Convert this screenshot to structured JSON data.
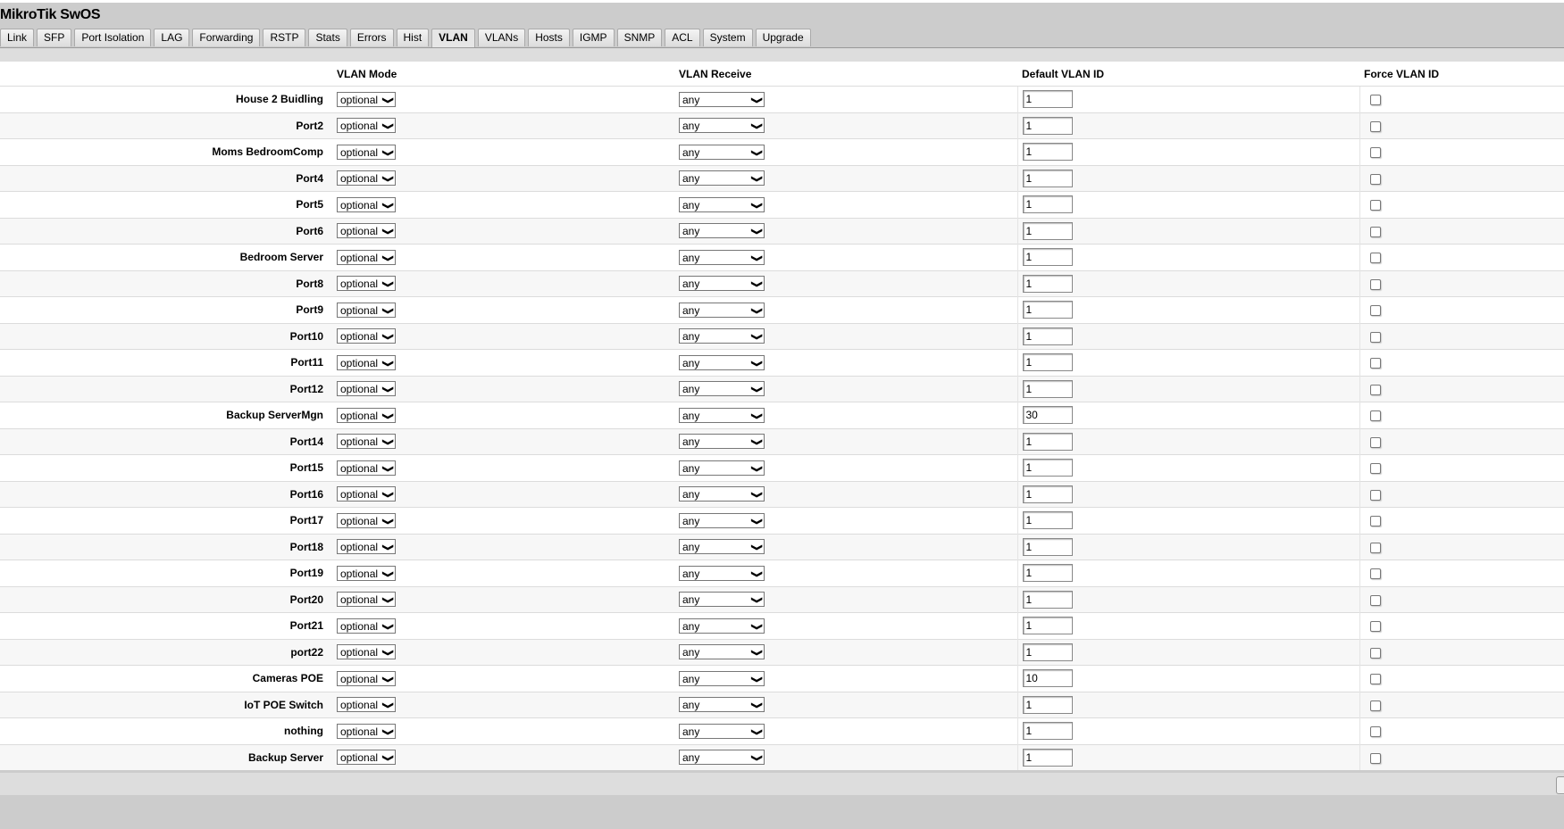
{
  "app": {
    "title": "MikroTik SwOS"
  },
  "tabs": [
    {
      "label": "Link"
    },
    {
      "label": "SFP"
    },
    {
      "label": "Port Isolation"
    },
    {
      "label": "LAG"
    },
    {
      "label": "Forwarding"
    },
    {
      "label": "RSTP"
    },
    {
      "label": "Stats"
    },
    {
      "label": "Errors"
    },
    {
      "label": "Hist"
    },
    {
      "label": "VLAN",
      "active": true
    },
    {
      "label": "VLANs"
    },
    {
      "label": "Hosts"
    },
    {
      "label": "IGMP"
    },
    {
      "label": "SNMP"
    },
    {
      "label": "ACL"
    },
    {
      "label": "System"
    },
    {
      "label": "Upgrade"
    }
  ],
  "table": {
    "headers": {
      "vlan_mode": "VLAN Mode",
      "vlan_receive": "VLAN Receive",
      "default_vlan_id": "Default VLAN ID",
      "force_vlan_id": "Force VLAN ID"
    },
    "rows": [
      {
        "port": "House 2 Buidling",
        "mode": "optional",
        "receive": "any",
        "default_vlan_id": "1",
        "force": false
      },
      {
        "port": "Port2",
        "mode": "optional",
        "receive": "any",
        "default_vlan_id": "1",
        "force": false
      },
      {
        "port": "Moms BedroomComp",
        "mode": "optional",
        "receive": "any",
        "default_vlan_id": "1",
        "force": false
      },
      {
        "port": "Port4",
        "mode": "optional",
        "receive": "any",
        "default_vlan_id": "1",
        "force": false
      },
      {
        "port": "Port5",
        "mode": "optional",
        "receive": "any",
        "default_vlan_id": "1",
        "force": false
      },
      {
        "port": "Port6",
        "mode": "optional",
        "receive": "any",
        "default_vlan_id": "1",
        "force": false
      },
      {
        "port": "Bedroom Server",
        "mode": "optional",
        "receive": "any",
        "default_vlan_id": "1",
        "force": false
      },
      {
        "port": "Port8",
        "mode": "optional",
        "receive": "any",
        "default_vlan_id": "1",
        "force": false
      },
      {
        "port": "Port9",
        "mode": "optional",
        "receive": "any",
        "default_vlan_id": "1",
        "force": false
      },
      {
        "port": "Port10",
        "mode": "optional",
        "receive": "any",
        "default_vlan_id": "1",
        "force": false
      },
      {
        "port": "Port11",
        "mode": "optional",
        "receive": "any",
        "default_vlan_id": "1",
        "force": false
      },
      {
        "port": "Port12",
        "mode": "optional",
        "receive": "any",
        "default_vlan_id": "1",
        "force": false
      },
      {
        "port": "Backup ServerMgn",
        "mode": "optional",
        "receive": "any",
        "default_vlan_id": "30",
        "force": false
      },
      {
        "port": "Port14",
        "mode": "optional",
        "receive": "any",
        "default_vlan_id": "1",
        "force": false
      },
      {
        "port": "Port15",
        "mode": "optional",
        "receive": "any",
        "default_vlan_id": "1",
        "force": false
      },
      {
        "port": "Port16",
        "mode": "optional",
        "receive": "any",
        "default_vlan_id": "1",
        "force": false
      },
      {
        "port": "Port17",
        "mode": "optional",
        "receive": "any",
        "default_vlan_id": "1",
        "force": false
      },
      {
        "port": "Port18",
        "mode": "optional",
        "receive": "any",
        "default_vlan_id": "1",
        "force": false
      },
      {
        "port": "Port19",
        "mode": "optional",
        "receive": "any",
        "default_vlan_id": "1",
        "force": false
      },
      {
        "port": "Port20",
        "mode": "optional",
        "receive": "any",
        "default_vlan_id": "1",
        "force": false
      },
      {
        "port": "Port21",
        "mode": "optional",
        "receive": "any",
        "default_vlan_id": "1",
        "force": false
      },
      {
        "port": "port22",
        "mode": "optional",
        "receive": "any",
        "default_vlan_id": "1",
        "force": false
      },
      {
        "port": "Cameras POE",
        "mode": "optional",
        "receive": "any",
        "default_vlan_id": "10",
        "force": false
      },
      {
        "port": "IoT POE Switch",
        "mode": "optional",
        "receive": "any",
        "default_vlan_id": "1",
        "force": false
      },
      {
        "port": "nothing",
        "mode": "optional",
        "receive": "any",
        "default_vlan_id": "1",
        "force": false
      },
      {
        "port": "Backup Server",
        "mode": "optional",
        "receive": "any",
        "default_vlan_id": "1",
        "force": false
      }
    ]
  },
  "icons": {
    "select_arrow": "chevron-down-icon"
  }
}
